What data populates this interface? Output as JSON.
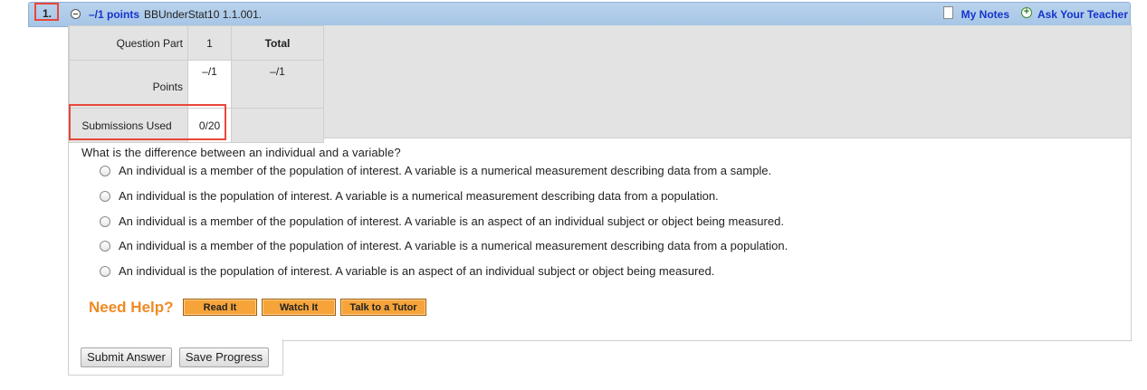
{
  "header": {
    "question_number": "1.",
    "points": "–/1 points",
    "question_id": "BBUnderStat10 1.1.001.",
    "my_notes": "My Notes",
    "ask_teacher": "Ask Your Teacher"
  },
  "score_table": {
    "part_label": "Question Part",
    "part_value": "1",
    "total_label": "Total",
    "points_label": "Points",
    "points_value": "–/1",
    "points_total": "–/1",
    "submissions_label": "Submissions Used",
    "submissions_value": "0/20"
  },
  "question": {
    "prompt": "What is the difference between an individual and a variable?",
    "options": [
      "An individual is a member of the population of interest. A variable is a numerical measurement describing data from a sample.",
      "An individual is the population of interest. A variable is a numerical measurement describing data from a population.",
      "An individual is a member of the population of interest. A variable is an aspect of an individual subject or object being measured.",
      "An individual is a member of the population of interest. A variable is a numerical measurement describing data from a population.",
      "An individual is the population of interest. A variable is an aspect of an individual subject or object being measured."
    ]
  },
  "help": {
    "label": "Need Help?",
    "read_it": "Read It",
    "watch_it": "Watch It",
    "talk_tutor": "Talk to a Tutor"
  },
  "actions": {
    "submit": "Submit Answer",
    "save": "Save Progress"
  },
  "colors": {
    "header_bg": "#a6c5e6",
    "link": "#1533cc",
    "highlight": "#e8473a",
    "help_orange": "#f08a24",
    "help_button": "#f6a43a"
  }
}
